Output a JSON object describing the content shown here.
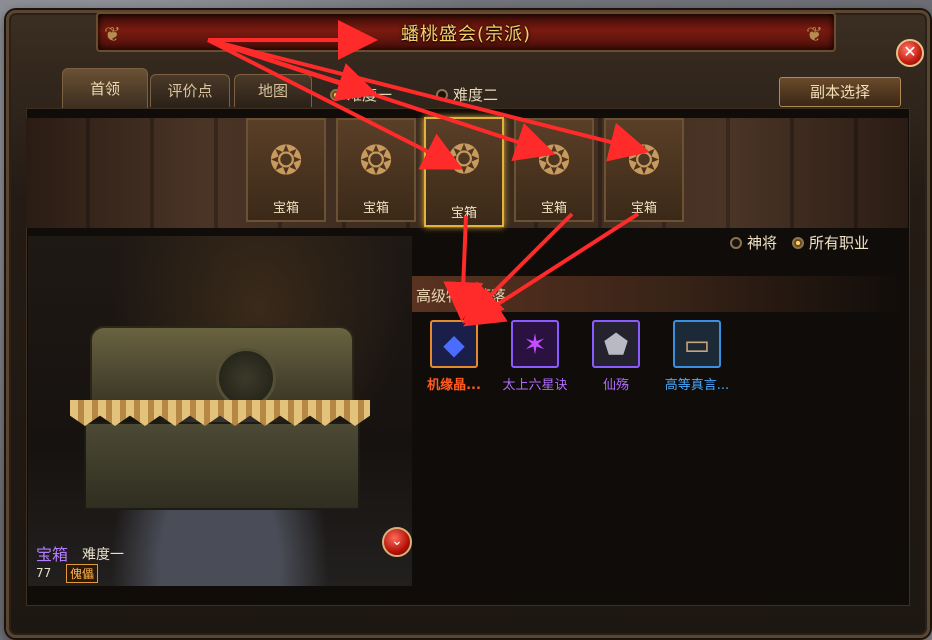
{
  "window": {
    "title": "蟠桃盛会(宗派)",
    "close_glyph": "✕"
  },
  "tabs": [
    {
      "label": "首领",
      "active": true
    },
    {
      "label": "评价点",
      "active": false
    },
    {
      "label": "地图",
      "active": false
    }
  ],
  "difficulty": [
    {
      "label": "难度一",
      "selected": true
    },
    {
      "label": "难度二",
      "selected": false
    }
  ],
  "dungeon_select_label": "副本选择",
  "chests": [
    {
      "label": "宝箱",
      "selected": false
    },
    {
      "label": "宝箱",
      "selected": false
    },
    {
      "label": "宝箱",
      "selected": true
    },
    {
      "label": "宝箱",
      "selected": false
    },
    {
      "label": "宝箱",
      "selected": false
    }
  ],
  "filters": [
    {
      "label": "神将",
      "selected": false
    },
    {
      "label": "所有职业",
      "selected": true
    }
  ],
  "loot": {
    "header": "高级物品掉落",
    "items": [
      {
        "name": "机缘晶...",
        "color": "#ff5a1f",
        "icon": "gem-icon",
        "glyph": "◆",
        "icon_color": "#4a6cff",
        "border": "#e58a2b"
      },
      {
        "name": "太上六星诀",
        "color": "#b06bff",
        "icon": "star-icon",
        "glyph": "✶",
        "icon_color": "#c44dff",
        "border": "#8a5cff"
      },
      {
        "name": "仙殇",
        "color": "#b06bff",
        "icon": "stone-icon",
        "glyph": "⬟",
        "icon_color": "#b9b9c4",
        "border": "#8a5cff"
      },
      {
        "name": "高等真言...",
        "color": "#4aa8ff",
        "icon": "chest-icon",
        "glyph": "▭",
        "icon_color": "#c9a37a",
        "border": "#3b8fe0"
      }
    ]
  },
  "preview": {
    "name": "宝箱",
    "difficulty": "难度一",
    "level": "77",
    "tag": "傀儡"
  },
  "colors": {
    "accent_gold": "#e2b23c",
    "arrow_red": "#ff2a2a"
  }
}
